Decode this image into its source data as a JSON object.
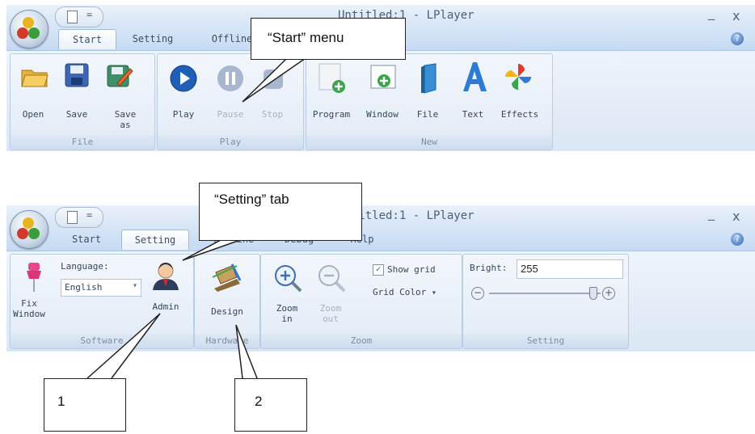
{
  "window1": {
    "title": "Untitled:1 - LPlayer",
    "minimize": "_",
    "close": "x",
    "help": "?",
    "tabs": [
      "Start",
      "Setting",
      "Offline"
    ],
    "groups": {
      "file": {
        "label": "File",
        "buttons": [
          "Open",
          "Save",
          "Save as"
        ]
      },
      "play": {
        "label": "Play",
        "buttons": [
          "Play",
          "Pause",
          "Stop"
        ]
      },
      "new": {
        "label": "New",
        "buttons": [
          "Program",
          "Window",
          "File",
          "Text",
          "Effects"
        ]
      }
    }
  },
  "window2": {
    "title": "Untitled:1 - LPlayer",
    "minimize": "_",
    "close": "x",
    "help": "?",
    "tabs": [
      "Start",
      "Setting",
      "Offline",
      "Debug",
      "Help"
    ],
    "groups": {
      "software": {
        "label": "Software",
        "fix_window": "Fix Window",
        "language_label": "Language:",
        "language_value": "English",
        "admin": "Admin"
      },
      "hardware": {
        "label": "Hardware",
        "design": "Design"
      },
      "zoom": {
        "label": "Zoom",
        "zoom_in": "Zoom in",
        "zoom_out": "Zoom out",
        "show_grid": "Show grid",
        "show_grid_checked": true,
        "grid_color": "Grid Color"
      },
      "setting": {
        "label": "Setting",
        "bright_label": "Bright:",
        "bright_value": "255",
        "bright_level": 255,
        "bright_max": 255
      }
    }
  },
  "callouts": {
    "start_menu": "“Start” menu",
    "setting_tab": "“Setting” tab",
    "one": "1",
    "two": "2"
  },
  "colors": {
    "ribbon_blue": "#dbe7f5",
    "play_blue": "#1f5fb8",
    "text_A_blue": "#2e7bd6"
  }
}
